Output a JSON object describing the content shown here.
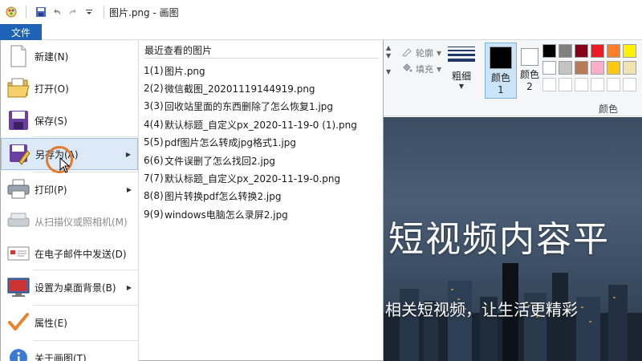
{
  "titlebar": {
    "title": "图片.png - 画图",
    "icons": [
      "paint-app-icon",
      "save-icon",
      "undo-icon",
      "redo-icon",
      "customize-qat-icon"
    ]
  },
  "file_tab": {
    "label": "文件"
  },
  "ribbon": {
    "outline_label": "轮廓",
    "fill_label": "填充",
    "thickness_label": "粗细",
    "color1_label": "颜色 1",
    "color2_label": "颜色 2",
    "colors_group_label": "颜色",
    "color1_value": "#000000",
    "color2_value": "#ffffff",
    "palette_row1": [
      "#000000",
      "#7f7f7f",
      "#880015",
      "#ed1c24",
      "#ff7f27",
      "#fff200"
    ],
    "palette_row2": [
      "#ffffff",
      "#c3c3c3",
      "#b97a57",
      "#ffaec9",
      "#ffc90e",
      "#efe4b0"
    ]
  },
  "file_menu": {
    "items": [
      {
        "label": "新建(N)",
        "icon": "new-file-icon"
      },
      {
        "label": "打开(O)",
        "icon": "open-folder-icon"
      },
      {
        "label": "保存(S)",
        "icon": "save-icon"
      },
      {
        "label": "另存为(A)",
        "icon": "save-as-icon",
        "selected": true,
        "submenu": true
      },
      {
        "label": "打印(P)",
        "icon": "printer-icon",
        "submenu": true
      },
      {
        "label": "从扫描仪或照相机(M)",
        "icon": "scanner-icon",
        "disabled": true
      },
      {
        "label": "在电子邮件中发送(D)",
        "icon": "email-icon"
      },
      {
        "label": "设置为桌面背景(B)",
        "icon": "desktop-background-icon",
        "submenu": true
      },
      {
        "label": "属性(E)",
        "icon": "checkmark-icon"
      },
      {
        "label": "关于画图(T)",
        "icon": "about-icon"
      }
    ],
    "recent_heading": "最近查看的图片",
    "recent": [
      {
        "num": "1(1)",
        "name": "图片.png"
      },
      {
        "num": "2(2)",
        "name": "微信截图_20201119144919.png"
      },
      {
        "num": "3(3)",
        "name": "回收站里面的东西删除了怎么恢复1.jpg"
      },
      {
        "num": "4(4)",
        "name": "默认标题_自定义px_2020-11-19-0 (1).png"
      },
      {
        "num": "5(5)",
        "name": "pdf图片怎么转成jpg格式1.jpg"
      },
      {
        "num": "6(6)",
        "name": "文件误删了怎么找回2.jpg"
      },
      {
        "num": "7(7)",
        "name": "默认标题_自定义px_2020-11-19-0.png"
      },
      {
        "num": "8(8)",
        "name": "图片转换pdf怎么转换2.jpg"
      },
      {
        "num": "9(9)",
        "name": "windows电脑怎么录屏2.jpg"
      }
    ]
  },
  "canvas": {
    "headline": "短视频内容平",
    "subline": "相关短视频，让生活更精彩"
  }
}
